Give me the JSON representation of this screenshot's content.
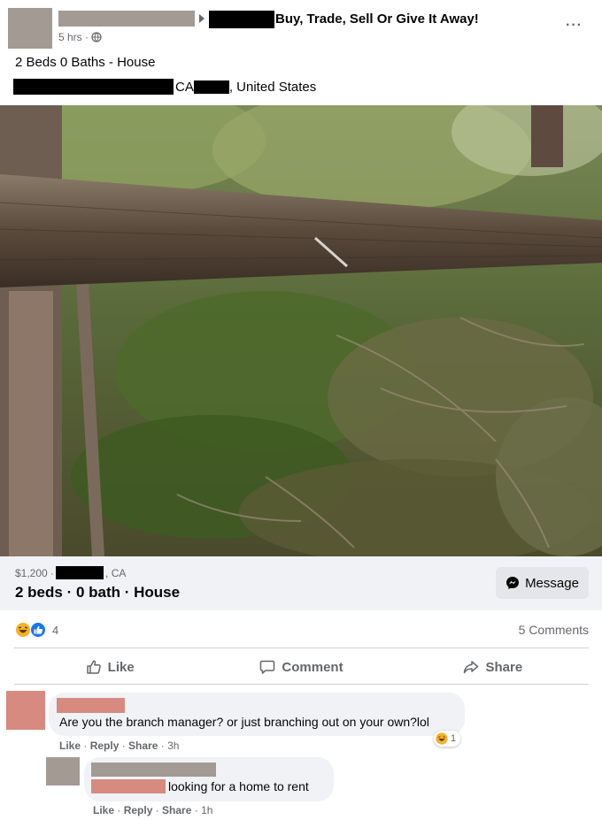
{
  "post": {
    "group": "Buy, Trade, Sell Or Give It Away!",
    "time": "5 hrs ·",
    "more": "···",
    "title": "2 Beds 0 Baths - House",
    "loc_state": "CA",
    "loc_country": ", United States"
  },
  "listing": {
    "price": "$1,200 ·",
    "price_state": ", CA",
    "summary": "2 beds · 0 bath · House",
    "message_label": "Message"
  },
  "stats": {
    "reaction_count": "4",
    "comments": "5 Comments"
  },
  "actions": {
    "like": "Like",
    "comment": "Comment",
    "share": "Share"
  },
  "comments": [
    {
      "text": "Are you the branch manager? or just branching out on your own?lol",
      "like": "Like",
      "reply": "Reply",
      "share": "Share",
      "time": "3h",
      "reaction_count": "1"
    },
    {
      "text": "looking for a home to rent",
      "like": "Like",
      "reply": "Reply",
      "share": "Share",
      "time": "1h"
    }
  ],
  "colors": {
    "redaction_gray": "#a49a94",
    "redaction_pink": "#d78a80",
    "like_blue": "#1877f2",
    "haha_yellow": "#f7b125"
  },
  "icons": [
    "globe-icon",
    "messenger-icon",
    "haha-reaction-icon",
    "like-reaction-icon",
    "thumbs-up-icon",
    "comment-icon",
    "share-icon"
  ]
}
